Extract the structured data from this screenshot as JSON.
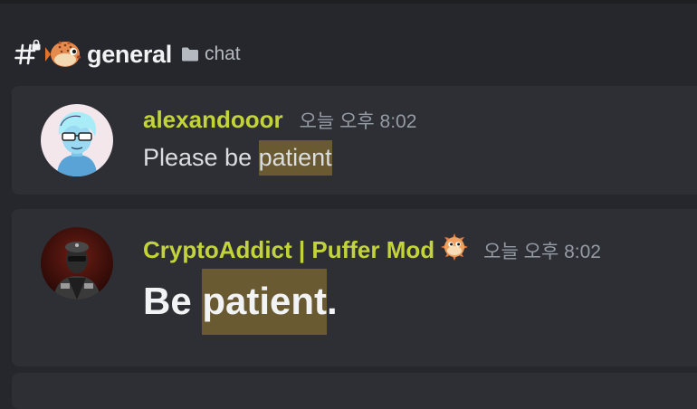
{
  "channel": {
    "name": "general",
    "category": "chat",
    "icons": [
      "hashtag-locked-icon",
      "pufferfish-emoji-icon",
      "folder-icon"
    ]
  },
  "messages": [
    {
      "username": "alexandooor",
      "timestamp": "오늘 오후 8:02",
      "body_prefix": "Please be ",
      "body_highlight": "patient",
      "body_suffix": "",
      "avatar_icon": "anime-avatar-icon",
      "username_color": "#c2d43a"
    },
    {
      "username": "CryptoAddict | Puffer Mod",
      "role_icon": "pufferfish-role-icon",
      "timestamp": "오늘 오후 8:02",
      "body_prefix": "Be ",
      "body_highlight": "patient",
      "body_suffix": ".",
      "avatar_icon": "masked-figure-avatar-icon",
      "username_color": "#c2d43a"
    }
  ],
  "colors": {
    "background": "#26272c",
    "card": "#2e2f35",
    "highlight": "#6a5a32",
    "timestamp": "#949ba4"
  }
}
